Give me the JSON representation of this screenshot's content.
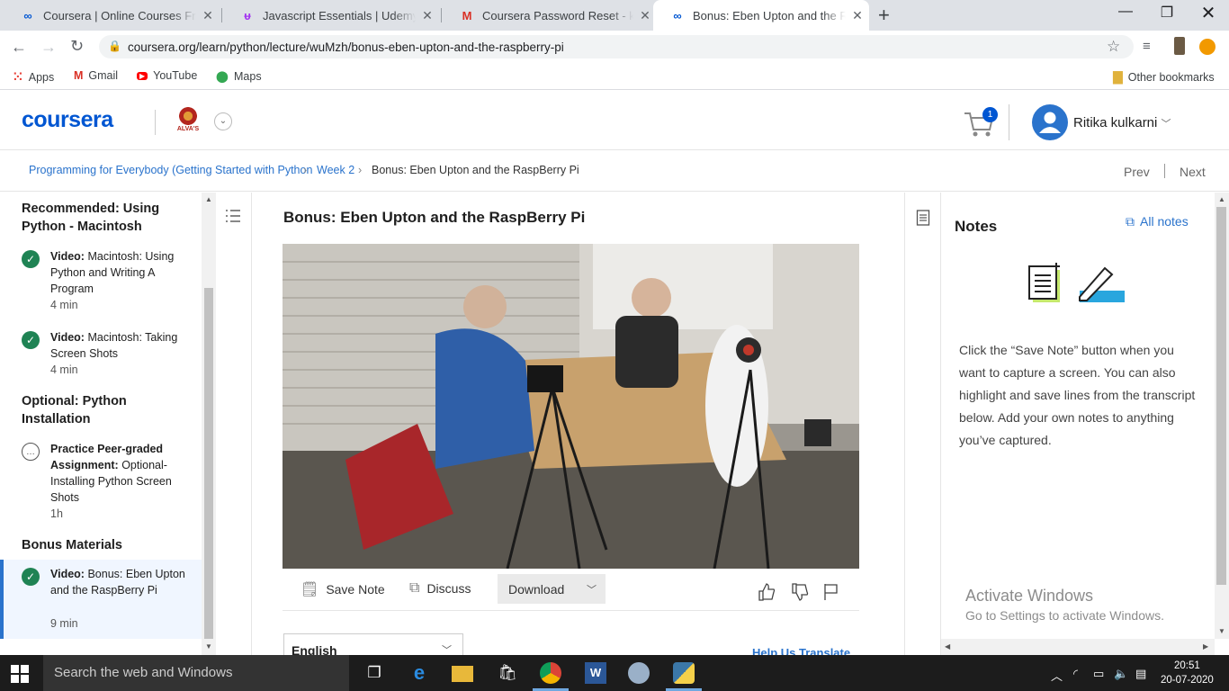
{
  "browser": {
    "tabs": [
      {
        "title": "Coursera | Online Courses From T",
        "icon": "coursera-icon"
      },
      {
        "title": "Javascript Essentials | Udemy",
        "icon": "udemy-icon"
      },
      {
        "title": "Coursera Password Reset - kulkarn",
        "icon": "gmail-icon"
      },
      {
        "title": "Bonus: Eben Upton and the Rasp",
        "icon": "coursera-icon",
        "active": true
      }
    ],
    "url": "coursera.org/learn/python/lecture/wuMzh/bonus-eben-upton-and-the-raspberry-pi",
    "bookmarks": [
      "Apps",
      "Gmail",
      "YouTube",
      "Maps"
    ],
    "other_bookmarks": "Other bookmarks"
  },
  "header": {
    "logo": "coursera",
    "partner_label": "ALVA'S",
    "cart_count": "1",
    "user_name": "Ritika kulkarni"
  },
  "breadcrumb": {
    "course": "Programming for Everybody (Getting Started with Python",
    "week": "Week 2",
    "current": "Bonus: Eben Upton and the RaspBerry Pi",
    "prev": "Prev",
    "next": "Next"
  },
  "sidebar": {
    "section1": "Recommended: Using Python - Macintosh",
    "item1": {
      "type": "Video:",
      "title": "Macintosh: Using Python and Writing A Program",
      "duration": "4 min"
    },
    "item2": {
      "type": "Video:",
      "title": "Macintosh: Taking Screen Shots",
      "duration": "4 min"
    },
    "section2": "Optional: Python Installation",
    "item3": {
      "type": "Practice Peer-graded Assignment:",
      "title": "Optional-Installing Python Screen Shots",
      "duration": "1h"
    },
    "section3": "Bonus Materials",
    "item4": {
      "type": "Video:",
      "title": "Bonus: Eben Upton and the RaspBerry Pi",
      "duration": "9 min"
    }
  },
  "lecture": {
    "title": "Bonus: Eben Upton and the RaspBerry Pi",
    "save_note": "Save Note",
    "discuss": "Discuss",
    "download": "Download",
    "language": "English",
    "help_translate": "Help Us Translate"
  },
  "notes": {
    "title": "Notes",
    "all_notes": "All notes",
    "body": "Click the “Save Note” button when you want to capture a screen. You can also highlight and save lines from the transcript below. Add your own notes to anything you’ve captured."
  },
  "watermark": {
    "line1": "Activate Windows",
    "line2": "Go to Settings to activate Windows."
  },
  "taskbar": {
    "search_placeholder": "Search the web and Windows",
    "time": "20:51",
    "date": "20-07-2020"
  },
  "colors": {
    "brand": "#0056d2",
    "link": "#2a73cc",
    "complete": "#1f8354"
  }
}
